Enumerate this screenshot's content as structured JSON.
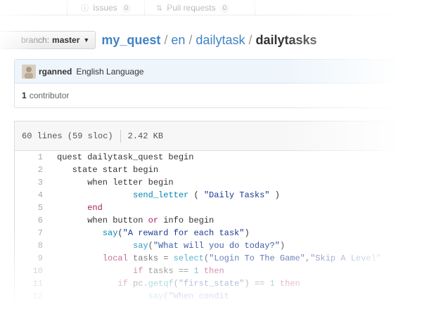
{
  "top_tabs": [
    {
      "label": "Issues",
      "count": "0"
    },
    {
      "label": "Pull requests",
      "count": "0"
    }
  ],
  "branch": {
    "label": "branch:",
    "value": "master"
  },
  "breadcrumb": {
    "repo": "my_quest",
    "sep": "/",
    "parts": [
      "en",
      "dailytask"
    ],
    "file": "dailytasks"
  },
  "commit": {
    "author": "rganned",
    "message": "English Language"
  },
  "contributors": {
    "count": "1",
    "label": "contributor"
  },
  "file_info": {
    "lines": "60 lines (59 sloc)",
    "size": "2.42 KB"
  },
  "code_lines": [
    {
      "n": "1",
      "tokens": [
        [
          "",
          "quest dailytask_quest begin"
        ]
      ]
    },
    {
      "n": "2",
      "tokens": [
        [
          "",
          "   state start begin"
        ]
      ]
    },
    {
      "n": "3",
      "tokens": [
        [
          "",
          "      when letter begin"
        ]
      ]
    },
    {
      "n": "4",
      "tokens": [
        [
          "",
          "               "
        ],
        [
          "fn",
          "send_letter"
        ],
        [
          "",
          " ( "
        ],
        [
          "str",
          "\"Daily Tasks\""
        ],
        [
          "",
          " )"
        ]
      ]
    },
    {
      "n": "5",
      "tokens": [
        [
          "",
          "      "
        ],
        [
          "kw",
          "end"
        ]
      ]
    },
    {
      "n": "6",
      "tokens": [
        [
          "",
          "      when button "
        ],
        [
          "kw",
          "or"
        ],
        [
          "",
          " info begin"
        ]
      ]
    },
    {
      "n": "7",
      "tokens": [
        [
          "",
          "         "
        ],
        [
          "fn",
          "say"
        ],
        [
          "",
          "("
        ],
        [
          "str",
          "\"A reward for each task\""
        ],
        [
          "",
          ")"
        ]
      ]
    },
    {
      "n": "8",
      "tokens": [
        [
          "",
          "               "
        ],
        [
          "fn",
          "say"
        ],
        [
          "",
          "("
        ],
        [
          "str",
          "\"What will you do today?\""
        ],
        [
          "",
          ")"
        ]
      ]
    },
    {
      "n": "9",
      "tokens": [
        [
          "",
          "         "
        ],
        [
          "kw",
          "local"
        ],
        [
          "",
          " tasks = "
        ],
        [
          "fn",
          "select"
        ],
        [
          "",
          "("
        ],
        [
          "str",
          "\"Login To The Game\""
        ],
        [
          "",
          ","
        ],
        [
          "str",
          "\"Skip A Level\""
        ]
      ]
    },
    {
      "n": "10",
      "tokens": [
        [
          "",
          "               "
        ],
        [
          "kw",
          "if"
        ],
        [
          "",
          " tasks == "
        ],
        [
          "num",
          "1"
        ],
        [
          "",
          " "
        ],
        [
          "kw",
          "then"
        ]
      ]
    },
    {
      "n": "11",
      "tokens": [
        [
          "",
          "            "
        ],
        [
          "kw",
          "if"
        ],
        [
          "",
          " pc."
        ],
        [
          "fn",
          "getqf"
        ],
        [
          "",
          "("
        ],
        [
          "str",
          "\"first_state\""
        ],
        [
          "",
          ") == "
        ],
        [
          "num",
          "1"
        ],
        [
          "",
          " "
        ],
        [
          "kw",
          "then"
        ]
      ]
    },
    {
      "n": "12",
      "tokens": [
        [
          "",
          "                  "
        ],
        [
          "fn",
          "say"
        ],
        [
          "",
          "("
        ],
        [
          "str",
          "\"When condit"
        ]
      ]
    }
  ],
  "colors": {
    "link": "#4183c4",
    "string": "#183691",
    "function": "#0086b3",
    "keyword": "#a71d5d",
    "commit_bg": "#eef5fb"
  }
}
